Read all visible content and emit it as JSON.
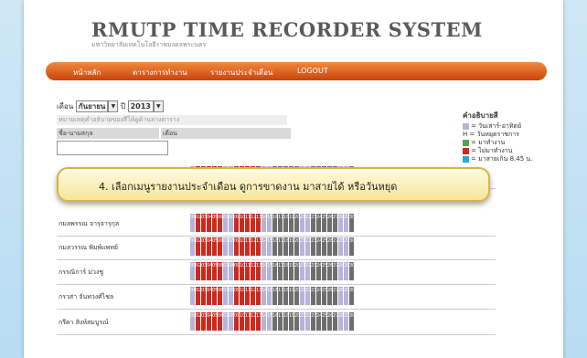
{
  "header": {
    "title": "RMUTP TIME RECORDER SYSTEM",
    "subtitle": "มหาวิทยาลัยเทคโนโลยีราชมงคลพระนคร"
  },
  "nav": {
    "items": [
      "หน้าหลัก",
      "ตารางการทำงาน",
      "รายงานประจำเดือน",
      "LOGOUT"
    ]
  },
  "filter": {
    "month_label": "เดือน",
    "month_value": "กันยายน",
    "year_label": "ปี",
    "year_value": "2013"
  },
  "hint_text": "หมายเหตุคำอธิบายของสีให้ดูด้านล่างตาราง",
  "table": {
    "col_name": "ชื่อ-นามสกุล",
    "col_month": "เดือน"
  },
  "legend": {
    "title": "คำอธิบายสี",
    "items": [
      {
        "label": "= วันเสาร์-อาทิตย์",
        "color": "#b7b3d9"
      },
      {
        "label": "H = วันหยุดราชการ",
        "color": ""
      },
      {
        "label": "= มาทำงาน",
        "color": "#4ea84e"
      },
      {
        "label": "= ไม่มาทำงาน",
        "color": "#cc2a1e"
      },
      {
        "label": "= มาสายเกิน 8.45 น.",
        "color": "#29a6dc"
      }
    ]
  },
  "callout": "4. เลือกเมนูรายงานประจำเดือน ดูการขาดงาน มาสายได้ หรือวันหยุด",
  "employees": [
    {
      "name": "กมลทิพย์ วิพกีสำรา"
    },
    {
      "name": "กมลพรรณ จารุจารุกุล"
    },
    {
      "name": "กมลวรรณ พิมพ์แพทย์"
    },
    {
      "name": "กรรณิการ์ ม่วงชู"
    },
    {
      "name": "กรวสา จันทวงศ์ไชล"
    },
    {
      "name": "กรีดา สิงห์สมบูรณ์"
    }
  ],
  "colors": {
    "nav": "#e0621f",
    "weekend": "#b7b3d9",
    "absent": "#cc2a1e",
    "present": "#555555"
  }
}
